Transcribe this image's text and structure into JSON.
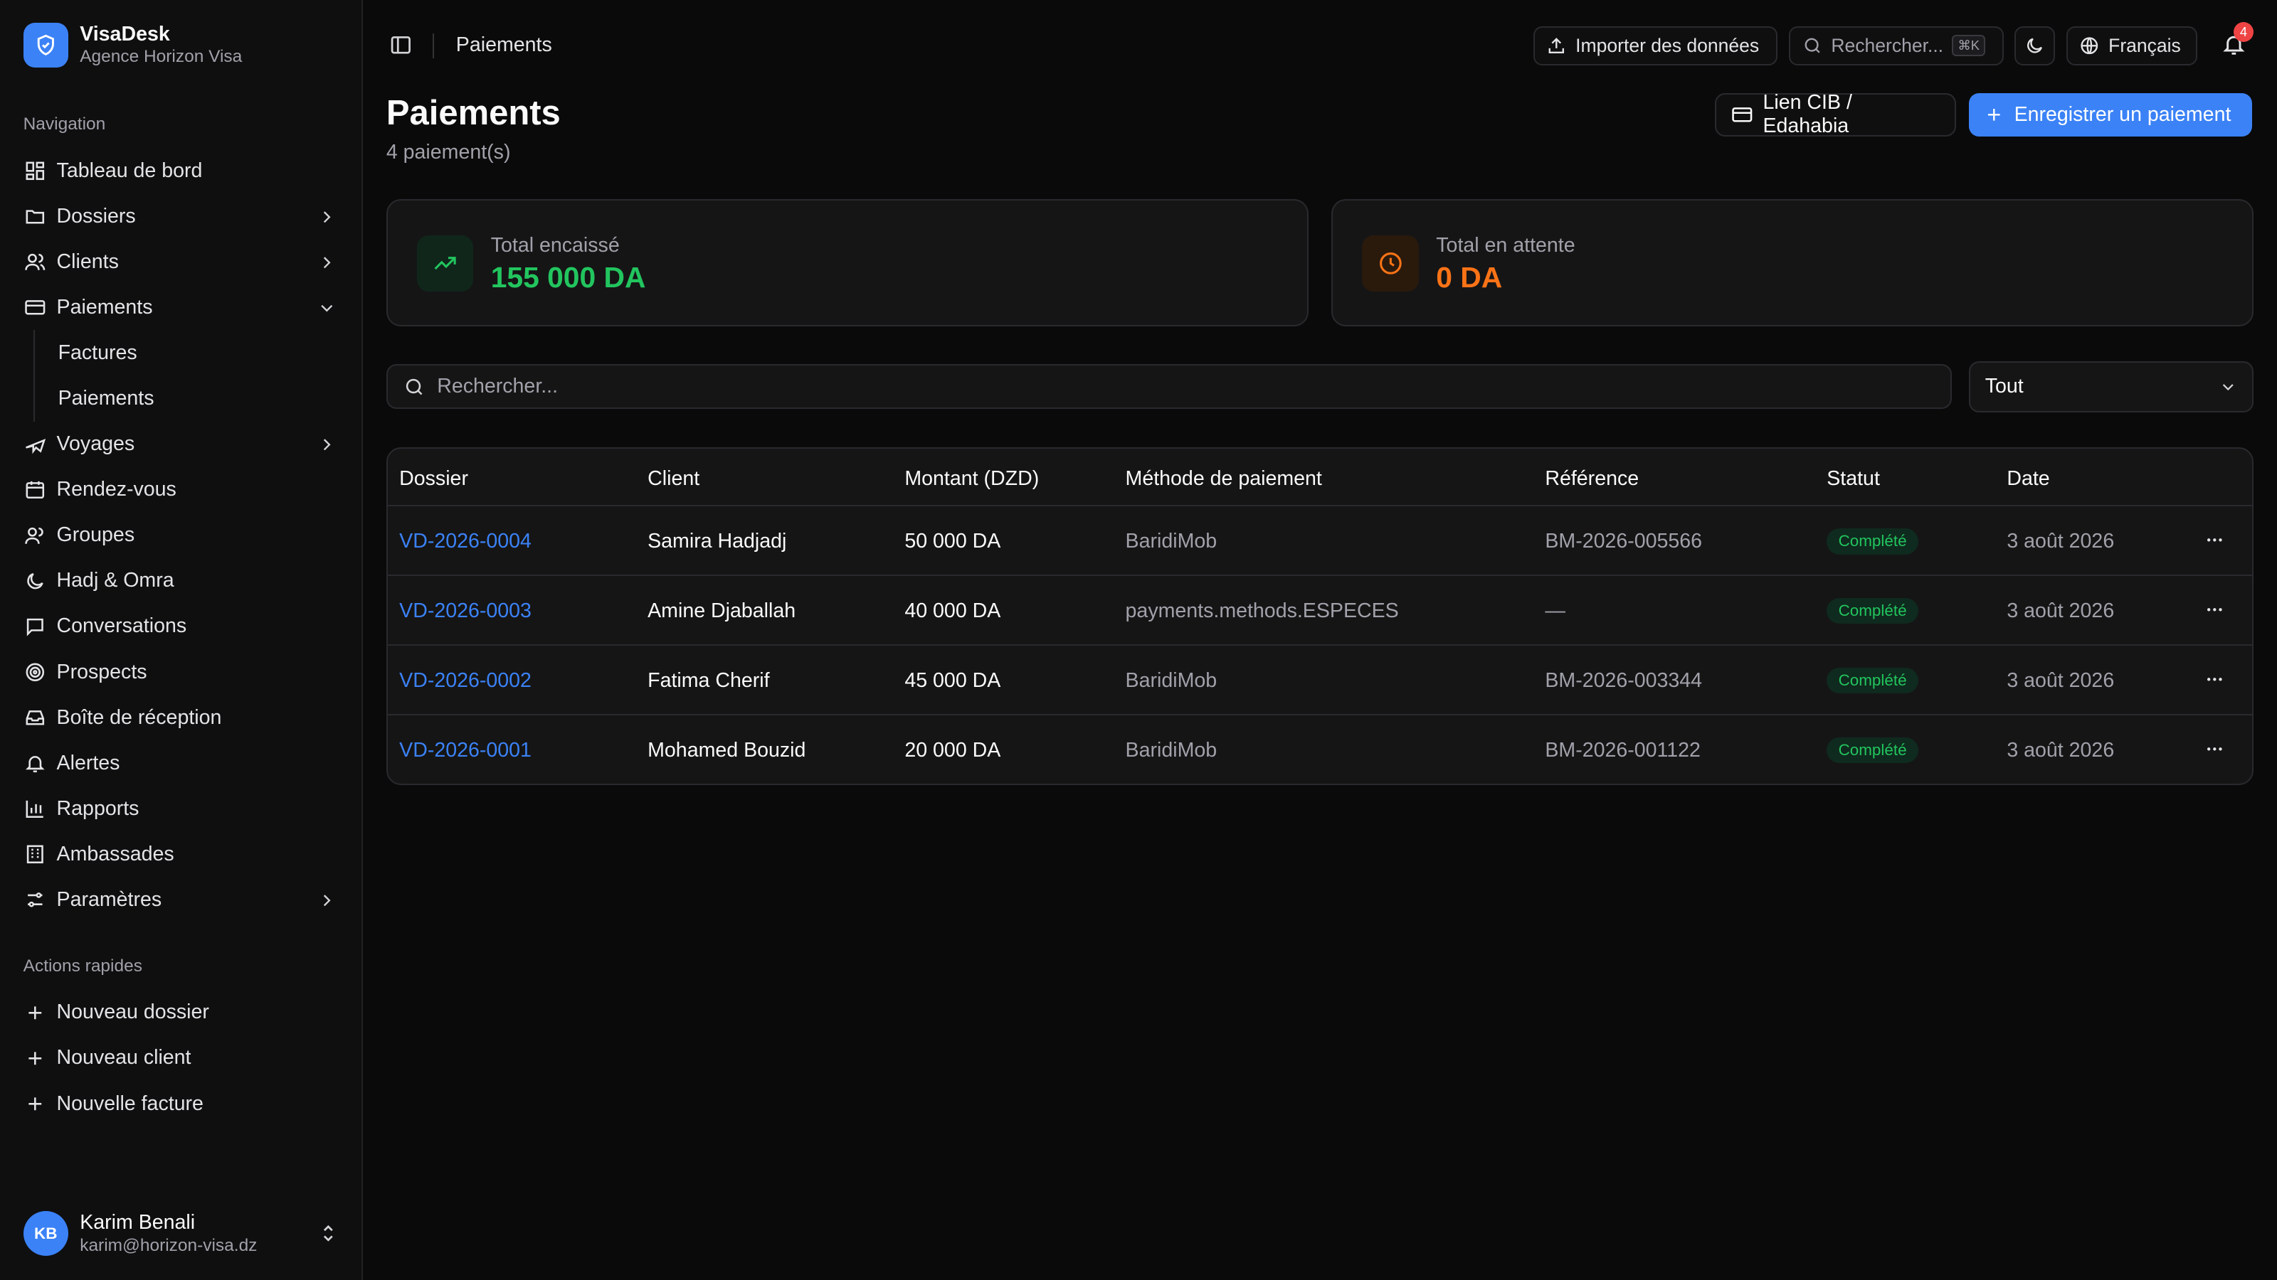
{
  "brand": {
    "name": "VisaDesk",
    "subtitle": "Agence Horizon Visa"
  },
  "nav": {
    "label": "Navigation",
    "items": [
      {
        "label": "Tableau de bord",
        "icon": "dashboard-icon"
      },
      {
        "label": "Dossiers",
        "icon": "folder-icon",
        "chevron": "right"
      },
      {
        "label": "Clients",
        "icon": "users-icon",
        "chevron": "right"
      },
      {
        "label": "Paiements",
        "icon": "credit-card-icon",
        "chevron": "down"
      },
      {
        "label": "Factures"
      },
      {
        "label": "Paiements"
      },
      {
        "label": "Voyages",
        "icon": "plane-icon",
        "chevron": "right"
      },
      {
        "label": "Rendez-vous",
        "icon": "calendar-icon"
      },
      {
        "label": "Groupes",
        "icon": "group-icon"
      },
      {
        "label": "Hadj & Omra",
        "icon": "moon-icon"
      },
      {
        "label": "Conversations",
        "icon": "message-icon"
      },
      {
        "label": "Prospects",
        "icon": "target-icon"
      },
      {
        "label": "Boîte de réception",
        "icon": "inbox-icon"
      },
      {
        "label": "Alertes",
        "icon": "bell-icon"
      },
      {
        "label": "Rapports",
        "icon": "bar-chart-icon"
      },
      {
        "label": "Ambassades",
        "icon": "building-icon"
      },
      {
        "label": "Paramètres",
        "icon": "settings-icon",
        "chevron": "right"
      }
    ]
  },
  "quick_actions": {
    "label": "Actions rapides",
    "items": [
      {
        "label": "Nouveau dossier"
      },
      {
        "label": "Nouveau client"
      },
      {
        "label": "Nouvelle facture"
      }
    ]
  },
  "user": {
    "initials": "KB",
    "name": "Karim Benali",
    "email": "karim@horizon-visa.dz"
  },
  "topbar": {
    "breadcrumb": "Paiements",
    "import_label": "Importer des données",
    "search_label": "Rechercher...",
    "shortcut": "⌘K",
    "language": "Français",
    "notification_count": "4"
  },
  "page": {
    "title": "Paiements",
    "subtitle": "4 paiement(s)",
    "cib_button": "Lien CIB / Edahabia",
    "primary_button": "Enregistrer un paiement"
  },
  "stats": {
    "collected": {
      "label": "Total encaissé",
      "value": "155 000 DA",
      "color": "#22c55e"
    },
    "pending": {
      "label": "Total en attente",
      "value": "0 DA",
      "color": "#f97316"
    }
  },
  "filters": {
    "search_placeholder": "Rechercher...",
    "status_value": "Tout"
  },
  "table": {
    "headers": [
      "Dossier",
      "Client",
      "Montant (DZD)",
      "Méthode de paiement",
      "Référence",
      "Statut",
      "Date"
    ],
    "rows": [
      {
        "dossier": "VD-2026-0004",
        "client": "Samira Hadjadj",
        "amount": "50 000 DA",
        "method": "BaridiMob",
        "reference": "BM-2026-005566",
        "status": "Complété",
        "date": "3 août 2026"
      },
      {
        "dossier": "VD-2026-0003",
        "client": "Amine Djaballah",
        "amount": "40 000 DA",
        "method": "payments.methods.ESPECES",
        "reference": "—",
        "status": "Complété",
        "date": "3 août 2026"
      },
      {
        "dossier": "VD-2026-0002",
        "client": "Fatima Cherif",
        "amount": "45 000 DA",
        "method": "BaridiMob",
        "reference": "BM-2026-003344",
        "status": "Complété",
        "date": "3 août 2026"
      },
      {
        "dossier": "VD-2026-0001",
        "client": "Mohamed Bouzid",
        "amount": "20 000 DA",
        "method": "BaridiMob",
        "reference": "BM-2026-001122",
        "status": "Complété",
        "date": "3 août 2026"
      }
    ]
  },
  "colors": {
    "accent": "#3b82f6",
    "success": "#22c55e",
    "warning": "#f97316",
    "danger": "#ef4444"
  }
}
